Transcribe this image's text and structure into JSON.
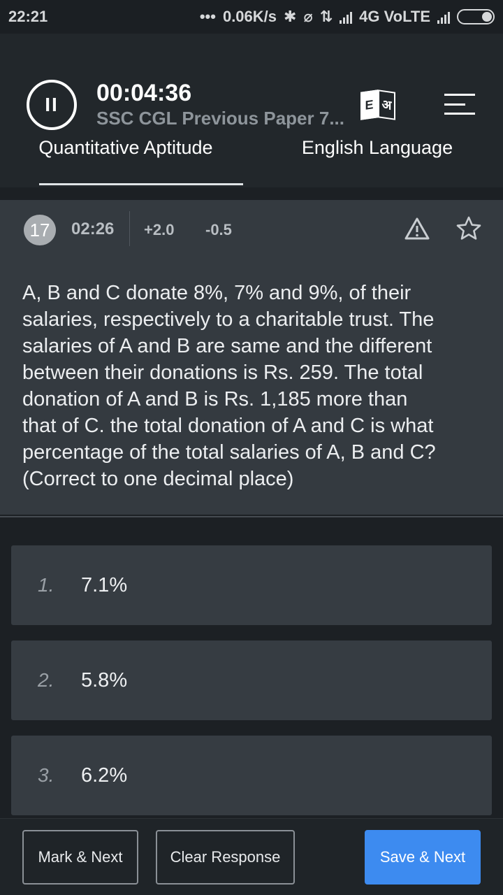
{
  "status_bar": {
    "time": "22:21",
    "dots": "•••",
    "speed": "0.06K/s",
    "network": "4G VoLTE"
  },
  "header": {
    "pause_label": "II",
    "timer": "00:04:36",
    "paper_title": "SSC CGL Previous Paper 7...",
    "lang_icon_left": "E",
    "lang_icon_right": "अ"
  },
  "tabs": [
    {
      "label": "Quantitative Aptitude",
      "active": true
    },
    {
      "label": "English Language",
      "active": false
    }
  ],
  "question": {
    "number": "17",
    "time": "02:26",
    "positive_marks": "+2.0",
    "negative_marks": "-0.5",
    "text_lines": [
      "A, B and C donate 8%, 7% and 9%, of their",
      "salaries, respectively to a charitable trust. The",
      "salaries of A and B are same and the different",
      "between their donations is Rs. 259. The total",
      "donation of A and B is Rs. 1,185 more than",
      "that of C. the total donation of A and C is what",
      "percentage of the total salaries of A, B and C?",
      "(Correct to one decimal place)"
    ]
  },
  "options": [
    {
      "number": "1.",
      "value": "7.1%"
    },
    {
      "number": "2.",
      "value": "5.8%"
    },
    {
      "number": "3.",
      "value": "6.2%"
    }
  ],
  "footer": {
    "mark_next": "Mark & Next",
    "clear_response": "Clear Response",
    "save_next": "Save & Next"
  },
  "colors": {
    "accent_button": "#3d8bf0",
    "question_panel": "#343a40",
    "background": "#1c2024"
  }
}
